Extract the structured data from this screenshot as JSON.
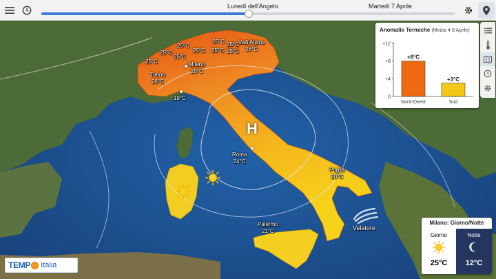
{
  "topbar": {
    "timeline_left_label": "Lunedì dell'Angelo",
    "timeline_right_label": "Martedì 7 Aprile",
    "timeline_progress": 0.5,
    "menu_icon": "menu-icon",
    "clock_icon": "clock-icon",
    "settings_icon": "gear-icon",
    "location_icon": "location-pin-icon"
  },
  "sidebar": {
    "items": [
      {
        "icon": "list-icon"
      },
      {
        "icon": "thermometer-icon"
      },
      {
        "icon": "map-icon"
      },
      {
        "icon": "history-icon"
      },
      {
        "icon": "settings-icon"
      }
    ]
  },
  "anomalies": {
    "title": "Anomalie Termiche",
    "subtitle": "(Media 4-9 Aprile)",
    "chart_data": {
      "type": "bar",
      "title": "Anomalie Termiche (Media 4-9 Aprile)",
      "categories": [
        "Nord-Ovest",
        "Sud"
      ],
      "values": [
        8,
        3
      ],
      "value_labels": [
        "+8°C",
        "+3°C"
      ],
      "bar_colors": [
        "#ee6a10",
        "#f3c817"
      ],
      "yticks": [
        "0",
        "+4",
        "+8",
        "+12"
      ],
      "ylim": [
        0,
        12
      ],
      "grid": false,
      "legend": "none"
    }
  },
  "map": {
    "pressure_marker": "H",
    "cities": [
      {
        "name": "Valli Alpine",
        "temp": "26°C"
      },
      {
        "name": "Torino",
        "temp": "26°C"
      },
      {
        "name": "Milano",
        "temp": "25°C"
      },
      {
        "name": "Genova",
        "temp": "19°C"
      },
      {
        "name": "Roma",
        "temp": "24°C"
      },
      {
        "name": "Puglia",
        "temp": "20°C"
      },
      {
        "name": "Palermo",
        "temp": "21°C"
      }
    ],
    "small_temps": [
      "25°C",
      "25°C",
      "25°C",
      "25°C",
      "25°C",
      "25°C",
      "25°C",
      "25°C",
      "25°C"
    ],
    "velature_label": "Velature",
    "sun_icon": "sun-icon",
    "cloud_icon": "cloud-icon"
  },
  "logo": {
    "brand_a": "TEMP",
    "brand_b": "Italia"
  },
  "city_card": {
    "title": "Milano: Giorno/Notte",
    "day_label": "Giorno",
    "day_temp": "25°C",
    "night_label": "Notte",
    "night_temp": "12°C"
  },
  "colors": {
    "sea": "#1d4f8e",
    "land": "#4f6a3a",
    "italy_north": "#e8651a",
    "italy_south": "#f6c81c",
    "accent": "#3a7bd5"
  }
}
